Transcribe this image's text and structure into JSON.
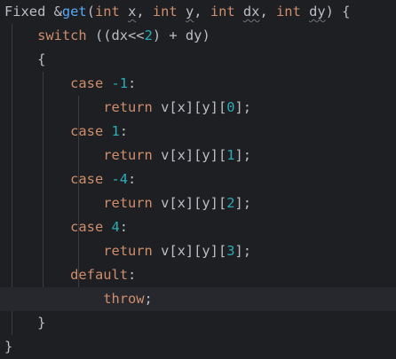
{
  "editor": {
    "lines": [
      {
        "tokens": [
          {
            "t": "Fixed &",
            "c": "txt"
          },
          {
            "t": "get",
            "c": "fn"
          },
          {
            "t": "(",
            "c": "txt"
          },
          {
            "t": "int",
            "c": "kw"
          },
          {
            "t": " ",
            "c": "txt"
          },
          {
            "t": "x",
            "c": "param"
          },
          {
            "t": ", ",
            "c": "txt"
          },
          {
            "t": "int",
            "c": "kw"
          },
          {
            "t": " ",
            "c": "txt"
          },
          {
            "t": "y",
            "c": "param"
          },
          {
            "t": ", ",
            "c": "txt"
          },
          {
            "t": "int",
            "c": "kw"
          },
          {
            "t": " ",
            "c": "txt"
          },
          {
            "t": "dx",
            "c": "param"
          },
          {
            "t": ", ",
            "c": "txt"
          },
          {
            "t": "int",
            "c": "kw"
          },
          {
            "t": " ",
            "c": "txt"
          },
          {
            "t": "dy",
            "c": "param"
          },
          {
            "t": ") {",
            "c": "txt"
          }
        ]
      },
      {
        "tokens": [
          {
            "t": "    ",
            "c": "txt"
          },
          {
            "t": "switch",
            "c": "kw"
          },
          {
            "t": " ((dx<<",
            "c": "txt"
          },
          {
            "t": "2",
            "c": "num"
          },
          {
            "t": ") + dy)",
            "c": "txt"
          }
        ]
      },
      {
        "tokens": [
          {
            "t": "    {",
            "c": "txt"
          }
        ]
      },
      {
        "tokens": [
          {
            "t": "        ",
            "c": "txt"
          },
          {
            "t": "case",
            "c": "kw"
          },
          {
            "t": " ",
            "c": "txt"
          },
          {
            "t": "-1",
            "c": "num"
          },
          {
            "t": ":",
            "c": "txt"
          }
        ]
      },
      {
        "tokens": [
          {
            "t": "            ",
            "c": "txt"
          },
          {
            "t": "return",
            "c": "kw"
          },
          {
            "t": " v[x][y][",
            "c": "txt"
          },
          {
            "t": "0",
            "c": "num"
          },
          {
            "t": "];",
            "c": "txt"
          }
        ]
      },
      {
        "tokens": [
          {
            "t": "        ",
            "c": "txt"
          },
          {
            "t": "case",
            "c": "kw"
          },
          {
            "t": " ",
            "c": "txt"
          },
          {
            "t": "1",
            "c": "num"
          },
          {
            "t": ":",
            "c": "txt"
          }
        ]
      },
      {
        "tokens": [
          {
            "t": "            ",
            "c": "txt"
          },
          {
            "t": "return",
            "c": "kw"
          },
          {
            "t": " v[x][y][",
            "c": "txt"
          },
          {
            "t": "1",
            "c": "num"
          },
          {
            "t": "];",
            "c": "txt"
          }
        ]
      },
      {
        "tokens": [
          {
            "t": "        ",
            "c": "txt"
          },
          {
            "t": "case",
            "c": "kw"
          },
          {
            "t": " ",
            "c": "txt"
          },
          {
            "t": "-4",
            "c": "num"
          },
          {
            "t": ":",
            "c": "txt"
          }
        ]
      },
      {
        "tokens": [
          {
            "t": "            ",
            "c": "txt"
          },
          {
            "t": "return",
            "c": "kw"
          },
          {
            "t": " v[x][y][",
            "c": "txt"
          },
          {
            "t": "2",
            "c": "num"
          },
          {
            "t": "];",
            "c": "txt"
          }
        ]
      },
      {
        "tokens": [
          {
            "t": "        ",
            "c": "txt"
          },
          {
            "t": "case",
            "c": "kw"
          },
          {
            "t": " ",
            "c": "txt"
          },
          {
            "t": "4",
            "c": "num"
          },
          {
            "t": ":",
            "c": "txt"
          }
        ]
      },
      {
        "tokens": [
          {
            "t": "            ",
            "c": "txt"
          },
          {
            "t": "return",
            "c": "kw"
          },
          {
            "t": " v[x][y][",
            "c": "txt"
          },
          {
            "t": "3",
            "c": "num"
          },
          {
            "t": "];",
            "c": "txt"
          }
        ]
      },
      {
        "tokens": [
          {
            "t": "        ",
            "c": "txt"
          },
          {
            "t": "default",
            "c": "kw"
          },
          {
            "t": ":",
            "c": "txt"
          }
        ]
      },
      {
        "tokens": [
          {
            "t": "            ",
            "c": "txt"
          },
          {
            "t": "throw",
            "c": "kw"
          },
          {
            "t": ";",
            "c": "txt"
          }
        ]
      },
      {
        "tokens": [
          {
            "t": "    }",
            "c": "txt"
          }
        ]
      },
      {
        "tokens": [
          {
            "t": "}",
            "c": "txt"
          }
        ]
      }
    ],
    "current_line": 12,
    "colors": {
      "background": "#1e1f22",
      "current_line": "#26282e",
      "keyword": "#cf8e6d",
      "function": "#56a8f5",
      "number": "#2aacb8",
      "text": "#bcbec4"
    }
  }
}
